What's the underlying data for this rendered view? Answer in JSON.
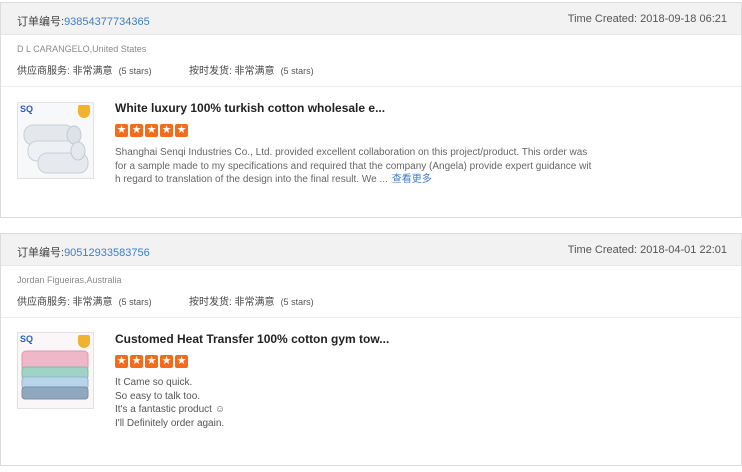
{
  "orders": [
    {
      "order_label": "订单编号:",
      "order_number": "93854377734365",
      "time_created": "Time Created: 2018-09-18 06:21",
      "buyer": "D L CARANGELO,United States",
      "service_label": "供应商服务: 非常满意",
      "service_stars": "(5 stars)",
      "delivery_label": "按时发货: 非常满意",
      "delivery_stars": "(5 stars)",
      "product_title": "White luxury 100% turkish cotton wholesale e...",
      "rating": 5,
      "review_lines": [
        "Shanghai Senqi Industries Co., Ltd. provided excellent collaboration on this project/product.  This order was",
        "for a sample made to my specifications and required that the company (Angela) provide expert guidance wit",
        "h regard to translation of the design into the final result.  We ..."
      ],
      "see_more": "查看更多",
      "thumb_logo": "SQ",
      "thumb_color": "#e9eef2"
    },
    {
      "order_label": "订单编号:",
      "order_number": "90512933583756",
      "time_created": "Time Created: 2018-04-01 22:01",
      "buyer": "Jordan Figueiras,Australia",
      "service_label": "供应商服务: 非常满意",
      "service_stars": "(5 stars)",
      "delivery_label": "按时发货: 非常满意",
      "delivery_stars": "(5 stars)",
      "product_title": "Customed Heat Transfer 100% cotton gym tow...",
      "rating": 5,
      "review_lines": [
        "It Came so quick.",
        "So easy to talk too.",
        "It's a fantastic product ☺",
        "I'll Definitely order again."
      ],
      "thumb_logo": "SQ",
      "thumb_color": "#f3d3dd"
    }
  ]
}
